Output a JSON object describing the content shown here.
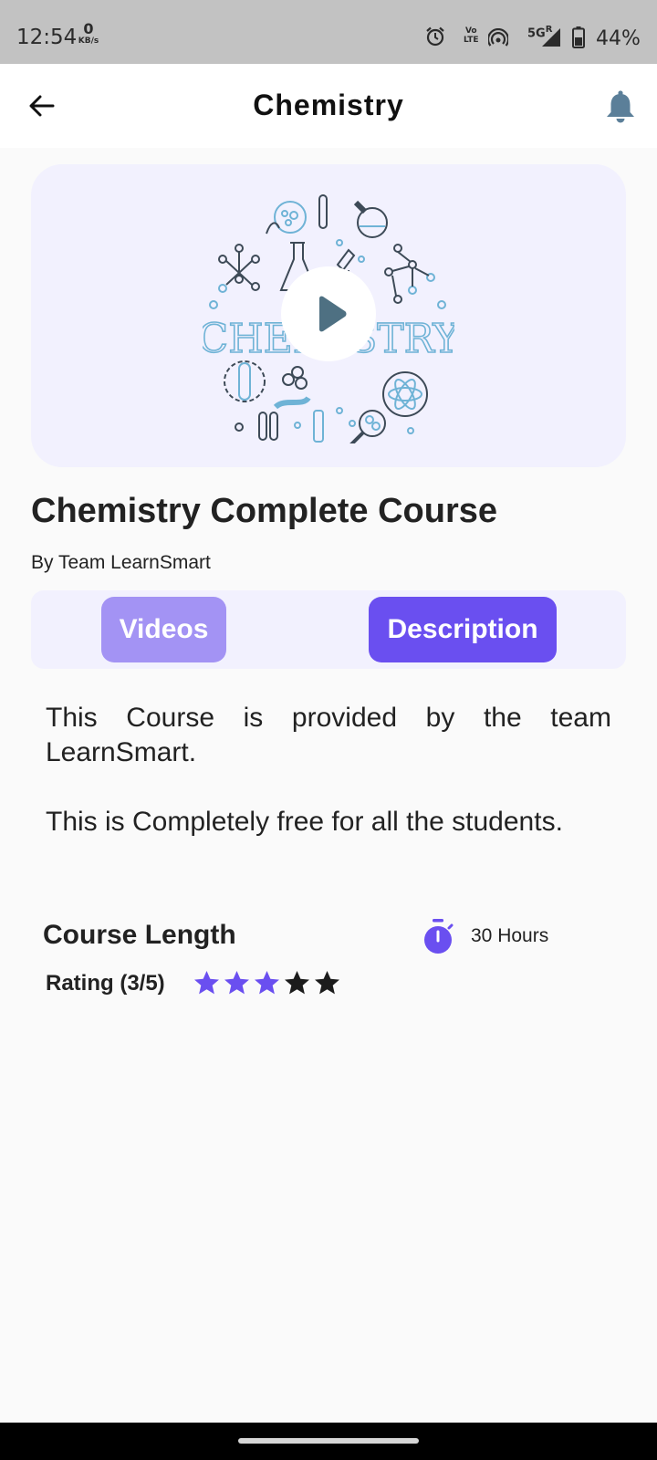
{
  "status_bar": {
    "time": "12:54",
    "net_speed_value": "0",
    "net_speed_unit": "KB/s",
    "volte_line1": "Vo",
    "volte_line2": "LTE",
    "network": "5G",
    "network_suffix": "R",
    "battery": "44%",
    "icons": [
      "alarm-icon",
      "volte-icon",
      "hotspot-icon",
      "signal-icon",
      "battery-icon"
    ]
  },
  "app_bar": {
    "title": "Chemistry",
    "back_icon": "arrow-left-icon",
    "bell_icon": "bell-icon",
    "bell_color": "#5b7f99"
  },
  "video": {
    "thumbnail_word": "CHEMISTRY",
    "play_icon": "play-icon",
    "card_color": "#f2f1fe",
    "line_color": "#6fb3d6"
  },
  "course": {
    "title": "Chemistry Complete Course",
    "author": "By Team LearnSmart"
  },
  "tabs": [
    {
      "label": "Videos",
      "selected": false,
      "color": "#a393f4"
    },
    {
      "label": "Description",
      "selected": true,
      "color": "#6a4ff0"
    }
  ],
  "description": {
    "paragraph_1": "This Course is provided by the team LearnSmart.",
    "paragraph_2": "This is Completely free for all the students."
  },
  "details": {
    "length_label": "Course Length",
    "length_value": "30 Hours",
    "timer_icon": "timer-icon",
    "rating_label": "Rating (3/5)",
    "rating": 3,
    "rating_max": 5,
    "star_filled_color": "#6a4ff0",
    "star_empty_color": "#1c1c1c"
  }
}
